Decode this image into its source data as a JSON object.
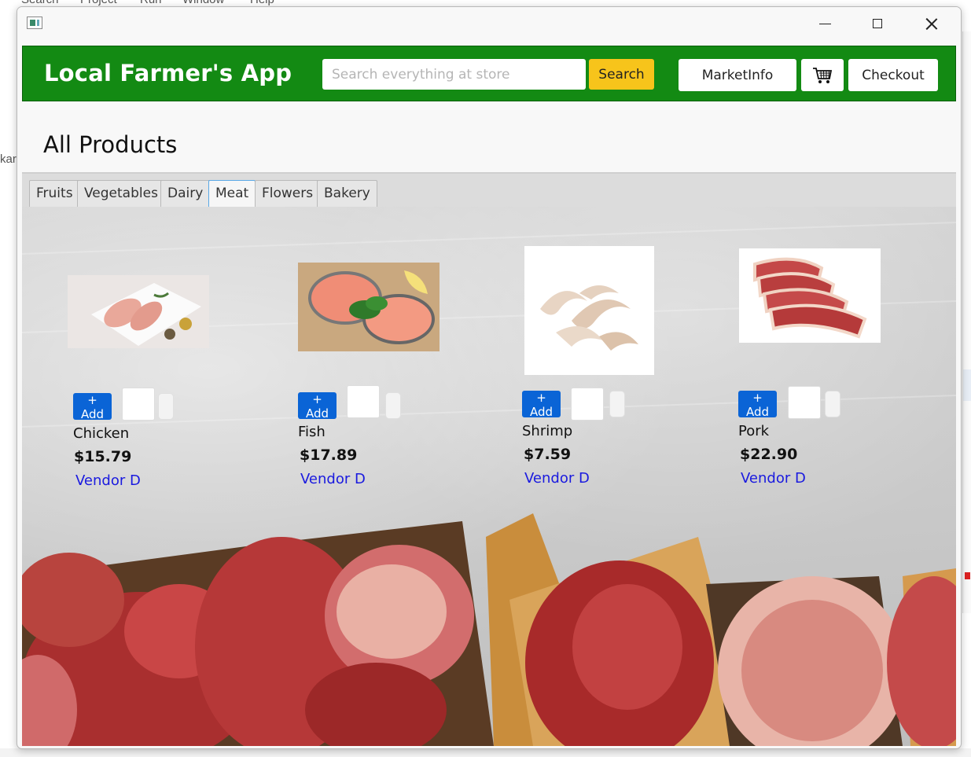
{
  "background": {
    "menu_items": [
      "Search",
      "Project",
      "Run",
      "Window",
      "Help"
    ],
    "left_fragment": "kar"
  },
  "header": {
    "title": "Local Farmer's App",
    "search_placeholder": "Search everything at store",
    "search_value": "",
    "search_button": "Search",
    "market_button": "MarketInfo",
    "cart_icon": "shopping-cart-icon",
    "checkout_button": "Checkout",
    "accent_color": "#138a13",
    "search_button_color": "#f7c41b"
  },
  "page_title": "All Products",
  "tabs": [
    {
      "label": "Fruits",
      "active": false
    },
    {
      "label": "Vegetables",
      "active": false
    },
    {
      "label": "Dairy",
      "active": false
    },
    {
      "label": "Meat",
      "active": true
    },
    {
      "label": "Flowers",
      "active": false
    },
    {
      "label": "Bakery",
      "active": false
    }
  ],
  "products": [
    {
      "name": "Chicken",
      "price": "$15.79",
      "vendor": "Vendor D",
      "add_label": "+ Add",
      "quantity": ""
    },
    {
      "name": "Fish",
      "price": "$17.89",
      "vendor": "Vendor D",
      "add_label": "+ Add",
      "quantity": ""
    },
    {
      "name": "Shrimp",
      "price": "$7.59",
      "vendor": "Vendor D",
      "add_label": "+ Add",
      "quantity": ""
    },
    {
      "name": "Pork",
      "price": "$22.90",
      "vendor": "Vendor D",
      "add_label": "+ Add",
      "quantity": ""
    }
  ]
}
